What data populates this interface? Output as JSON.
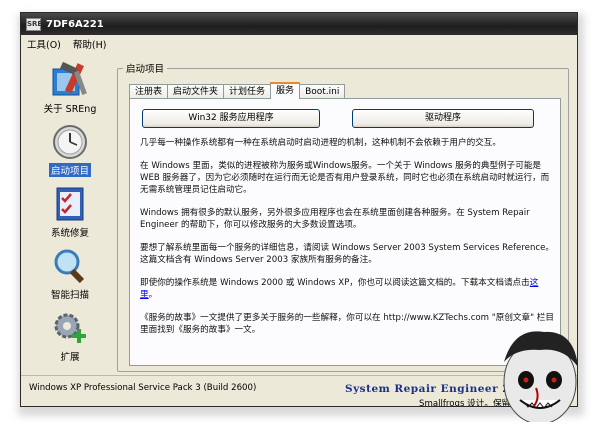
{
  "window": {
    "title": "7DF6A221",
    "app_icon_text": "SRE"
  },
  "menu": {
    "items": [
      "工具(O)",
      "帮助(H)"
    ]
  },
  "nav": {
    "items": [
      {
        "label": "关于 SREng",
        "icon": "wrench-hammer-icon",
        "active": false
      },
      {
        "label": "启动项目",
        "icon": "clock-icon",
        "active": true
      },
      {
        "label": "系统修复",
        "icon": "checklist-icon",
        "active": false
      },
      {
        "label": "智能扫描",
        "icon": "magnifier-icon",
        "active": false
      },
      {
        "label": "扩展",
        "icon": "gear-plus-icon",
        "active": false
      }
    ]
  },
  "group_title": "启动项目",
  "tabs": [
    {
      "label": "注册表",
      "active": false
    },
    {
      "label": "启动文件夹",
      "active": false
    },
    {
      "label": "计划任务",
      "active": false
    },
    {
      "label": "服务",
      "active": true
    },
    {
      "label": "Boot.ini",
      "active": false
    }
  ],
  "buttons": {
    "win32": "Win32 服务应用程序",
    "driver": "驱动程序"
  },
  "content": {
    "p1": "几乎每一种操作系统都有一种在系统启动时启动进程的机制，这种机制不会依赖于用户的交互。",
    "p2": "在 Windows 里面，类似的进程被称为服务或Windows服务。一个关于 Windows 服务的典型例子可能是 WEB 服务器了，因为它必须随时在运行而无论是否有用户登录系统，同时它也必须在系统启动时就运行，而无需系统管理员记住启动它。",
    "p3": "Windows 拥有很多的默认服务，另外很多应用程序也会在系统里面创建各种服务。在 System Repair Engineer 的帮助下，你可以修改服务的大多数设置选项。",
    "p4": "要想了解系统里面每一个服务的详细信息，请阅读 Windows Server 2003 System Services Reference。这篇文档含有 Windows Server 2003 家族所有服务的备注。",
    "p5_before": "即使你的操作系统是 Windows 2000 或 Windows XP，你也可以阅读这篇文档的。下载本文档请点击",
    "p5_link": "这里",
    "p5_after": "。",
    "p6_before": "《服务的故事》一文提供了更多关于服务的一些解释，你可以在 http://www.KZTechs.com \"原创文章\" 栏目里面找到《服务的故事》一文。"
  },
  "status": {
    "os": "Windows XP Professional Service Pack 3 (Build 2600)",
    "brand": "System Repair Engineer 2.6",
    "credit": "Smallfrogs 设计。保留所有"
  },
  "colors": {
    "titlebar": "#1d1d1d",
    "selection": "#316ac5",
    "brand": "#1d2e8a",
    "tab_highlight": "#e68b2c"
  }
}
